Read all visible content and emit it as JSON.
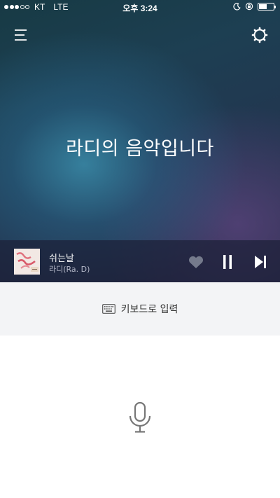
{
  "status_bar": {
    "carrier": "KT",
    "network": "LTE",
    "time": "오후 3:24",
    "signal_bars": 3,
    "signal_total": 5,
    "battery_level": 0.55
  },
  "header": {
    "menu_icon": "hamburger-menu-icon",
    "settings_icon": "settings-gear-icon"
  },
  "headline": "라디의 음악입니다",
  "now_playing": {
    "title": "쉬는날",
    "artist": "라디(Ra. D)",
    "album_art_text": "쉬는날",
    "like_icon": "heart-icon",
    "pause_icon": "pause-icon",
    "next_icon": "skip-next-icon"
  },
  "input": {
    "keyboard_label": "키보드로 입력",
    "keyboard_icon": "keyboard-icon",
    "mic_icon": "microphone-icon"
  },
  "colors": {
    "hero_dark": "#173a44",
    "hero_glow": "#3a8caa",
    "player_bar": "#1c2038",
    "keyboard_panel": "#f3f4f6",
    "mic_stroke": "#777777"
  }
}
